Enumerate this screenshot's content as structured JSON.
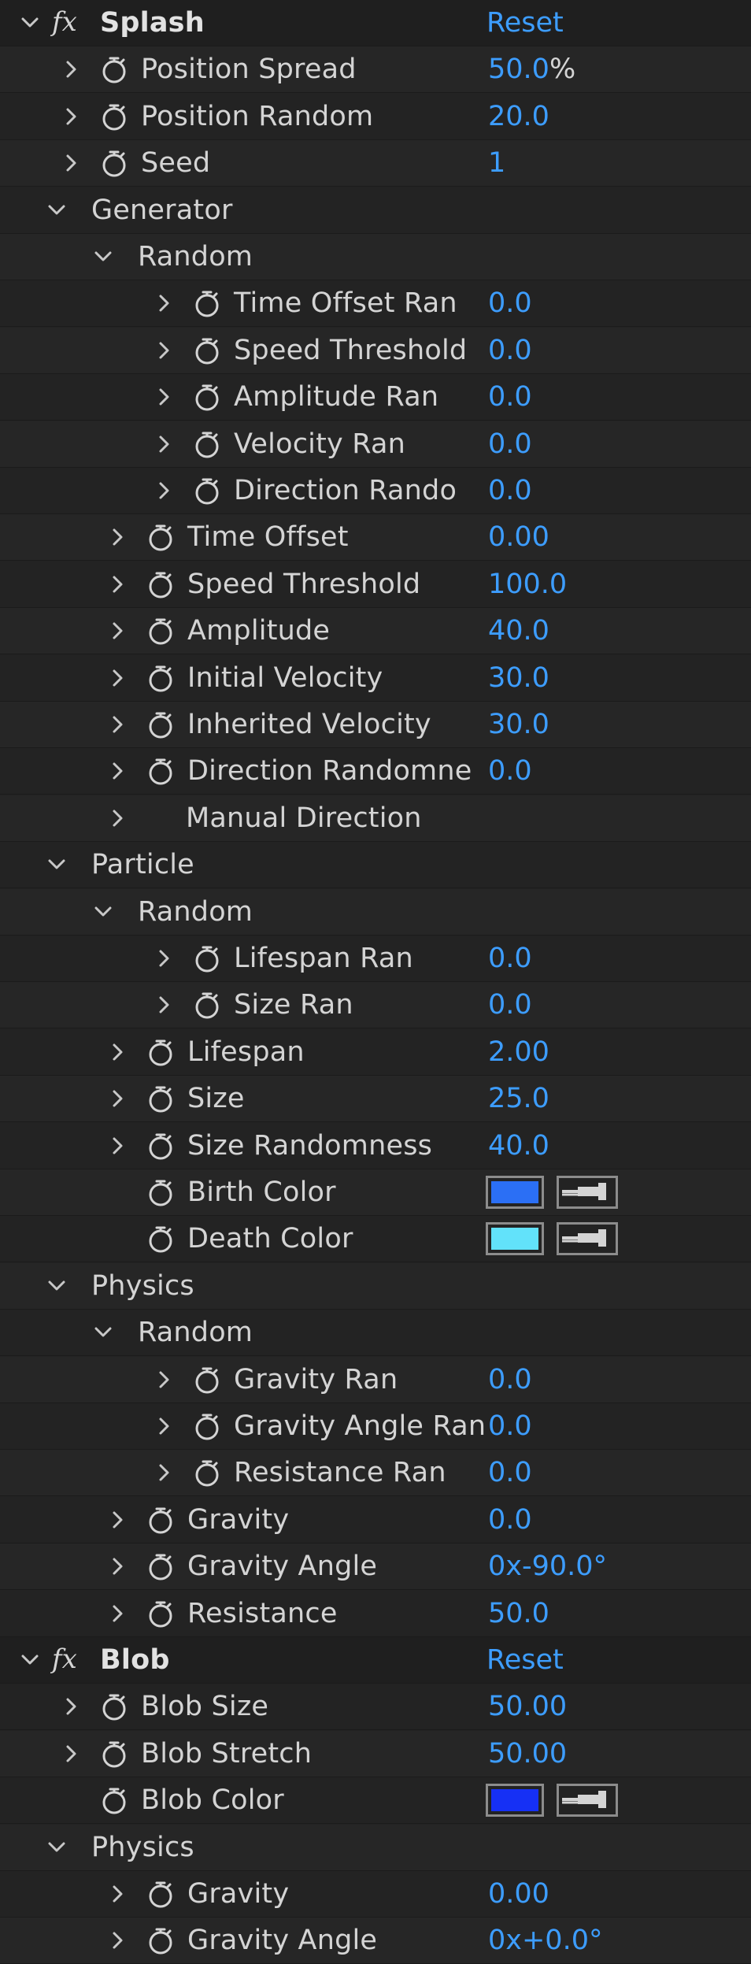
{
  "effects": [
    {
      "name": "Splash",
      "reset_label": "Reset",
      "fx_icon": "fx-icon",
      "rows": [
        {
          "depth": 1,
          "toggle": "collapsed",
          "stopwatch": true,
          "label": "Position Spread",
          "value": "50.0",
          "unit": "%"
        },
        {
          "depth": 1,
          "toggle": "collapsed",
          "stopwatch": true,
          "label": "Position Random",
          "value": "20.0"
        },
        {
          "depth": 1,
          "toggle": "collapsed",
          "stopwatch": true,
          "label": "Seed",
          "value": "1"
        },
        {
          "depth": 1,
          "toggle": "expanded",
          "stopwatch": false,
          "label": "Generator",
          "value": ""
        },
        {
          "depth": 2,
          "toggle": "expanded",
          "stopwatch": false,
          "label": "Random",
          "value": ""
        },
        {
          "depth": 3,
          "toggle": "collapsed",
          "stopwatch": true,
          "label": "Time Offset Ran",
          "value": "0.0"
        },
        {
          "depth": 3,
          "toggle": "collapsed",
          "stopwatch": true,
          "label": "Speed Threshold",
          "value": "0.0"
        },
        {
          "depth": 3,
          "toggle": "collapsed",
          "stopwatch": true,
          "label": "Amplitude Ran",
          "value": "0.0"
        },
        {
          "depth": 3,
          "toggle": "collapsed",
          "stopwatch": true,
          "label": "Velocity Ran",
          "value": "0.0"
        },
        {
          "depth": 3,
          "toggle": "collapsed",
          "stopwatch": true,
          "label": "Direction Rando",
          "value": "0.0"
        },
        {
          "depth": 2,
          "toggle": "collapsed",
          "stopwatch": true,
          "label": "Time Offset",
          "value": "0.00"
        },
        {
          "depth": 2,
          "toggle": "collapsed",
          "stopwatch": true,
          "label": "Speed Threshold",
          "value": "100.0"
        },
        {
          "depth": 2,
          "toggle": "collapsed",
          "stopwatch": true,
          "label": "Amplitude",
          "value": "40.0"
        },
        {
          "depth": 2,
          "toggle": "collapsed",
          "stopwatch": true,
          "label": "Initial Velocity",
          "value": "30.0"
        },
        {
          "depth": 2,
          "toggle": "collapsed",
          "stopwatch": true,
          "label": "Inherited Velocity",
          "value": "30.0"
        },
        {
          "depth": 2,
          "toggle": "collapsed",
          "stopwatch": true,
          "label": "Direction Randomne",
          "value": "0.0"
        },
        {
          "depth": 2,
          "toggle": "collapsed",
          "stopwatch": false,
          "label": "Manual Direction",
          "value": ""
        },
        {
          "depth": 1,
          "toggle": "expanded",
          "stopwatch": false,
          "label": "Particle",
          "value": ""
        },
        {
          "depth": 2,
          "toggle": "expanded",
          "stopwatch": false,
          "label": "Random",
          "value": ""
        },
        {
          "depth": 3,
          "toggle": "collapsed",
          "stopwatch": true,
          "label": "Lifespan Ran",
          "value": "0.0"
        },
        {
          "depth": 3,
          "toggle": "collapsed",
          "stopwatch": true,
          "label": "Size Ran",
          "value": "0.0"
        },
        {
          "depth": 2,
          "toggle": "collapsed",
          "stopwatch": true,
          "label": "Lifespan",
          "value": "2.00"
        },
        {
          "depth": 2,
          "toggle": "collapsed",
          "stopwatch": true,
          "label": "Size",
          "value": "25.0"
        },
        {
          "depth": 2,
          "toggle": "collapsed",
          "stopwatch": true,
          "label": "Size Randomness",
          "value": "40.0"
        },
        {
          "depth": 2,
          "toggle": "none",
          "stopwatch": true,
          "label": "Birth Color",
          "color": "#2b6ff5"
        },
        {
          "depth": 2,
          "toggle": "none",
          "stopwatch": true,
          "label": "Death Color",
          "color": "#62e2fa"
        },
        {
          "depth": 1,
          "toggle": "expanded",
          "stopwatch": false,
          "label": "Physics",
          "value": ""
        },
        {
          "depth": 2,
          "toggle": "expanded",
          "stopwatch": false,
          "label": "Random",
          "value": ""
        },
        {
          "depth": 3,
          "toggle": "collapsed",
          "stopwatch": true,
          "label": "Gravity Ran",
          "value": "0.0"
        },
        {
          "depth": 3,
          "toggle": "collapsed",
          "stopwatch": true,
          "label": "Gravity Angle Ran",
          "value": "0.0"
        },
        {
          "depth": 3,
          "toggle": "collapsed",
          "stopwatch": true,
          "label": "Resistance Ran",
          "value": "0.0"
        },
        {
          "depth": 2,
          "toggle": "collapsed",
          "stopwatch": true,
          "label": "Gravity",
          "value": "0.0"
        },
        {
          "depth": 2,
          "toggle": "collapsed",
          "stopwatch": true,
          "label": "Gravity Angle",
          "value": "0x-90.0°"
        },
        {
          "depth": 2,
          "toggle": "collapsed",
          "stopwatch": true,
          "label": "Resistance",
          "value": "50.0"
        }
      ]
    },
    {
      "name": "Blob",
      "reset_label": "Reset",
      "fx_icon": "fx-icon",
      "rows": [
        {
          "depth": 1,
          "toggle": "collapsed",
          "stopwatch": true,
          "label": "Blob Size",
          "value": "50.00"
        },
        {
          "depth": 1,
          "toggle": "collapsed",
          "stopwatch": true,
          "label": "Blob Stretch",
          "value": "50.00"
        },
        {
          "depth": 1,
          "toggle": "none",
          "stopwatch": true,
          "label": "Blob Color",
          "color": "#1630f5"
        },
        {
          "depth": 1,
          "toggle": "expanded",
          "stopwatch": false,
          "label": "Physics",
          "value": ""
        },
        {
          "depth": 2,
          "toggle": "collapsed",
          "stopwatch": true,
          "label": "Gravity",
          "value": "0.00"
        },
        {
          "depth": 2,
          "toggle": "collapsed",
          "stopwatch": true,
          "label": "Gravity Angle",
          "value": "0x+0.0°"
        }
      ]
    }
  ],
  "colors": {
    "background": "#232323",
    "value_text": "#3d9dff",
    "label_text": "#d4d4d4"
  },
  "icons": {
    "expanded": "chevron-down-icon",
    "collapsed": "chevron-right-icon",
    "stopwatch": "stopwatch-icon",
    "eyedropper": "eyedropper-icon"
  }
}
